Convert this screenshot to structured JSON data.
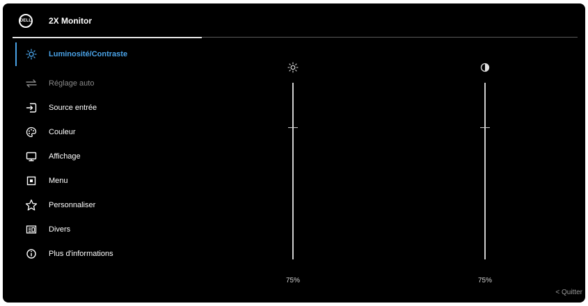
{
  "header": {
    "logo_text": "DELL",
    "title": "2X Monitor"
  },
  "menu": {
    "items": [
      {
        "label": "Luminosité/Contraste",
        "icon": "brightness-icon",
        "state": "active"
      },
      {
        "label": "Réglage auto",
        "icon": "auto-adjust-icon",
        "state": "disabled"
      },
      {
        "label": "Source entrée",
        "icon": "input-source-icon",
        "state": "normal"
      },
      {
        "label": "Couleur",
        "icon": "palette-icon",
        "state": "normal"
      },
      {
        "label": "Affichage",
        "icon": "display-icon",
        "state": "normal"
      },
      {
        "label": "Menu",
        "icon": "menu-icon",
        "state": "normal"
      },
      {
        "label": "Personnaliser",
        "icon": "star-icon",
        "state": "normal"
      },
      {
        "label": "Divers",
        "icon": "others-icon",
        "state": "normal"
      },
      {
        "label": "Plus d'informations",
        "icon": "info-icon",
        "state": "normal"
      }
    ]
  },
  "sliders": {
    "brightness": {
      "icon": "sun-icon",
      "value_label": "75%",
      "level": 0.75
    },
    "contrast": {
      "icon": "contrast-icon",
      "value_label": "75%",
      "level": 0.75
    }
  },
  "footer": {
    "quit_label": "< Quitter"
  },
  "colors": {
    "background": "#000000",
    "accent": "#4aa3e8",
    "text": "#ffffff",
    "muted": "#8a8a8a"
  }
}
